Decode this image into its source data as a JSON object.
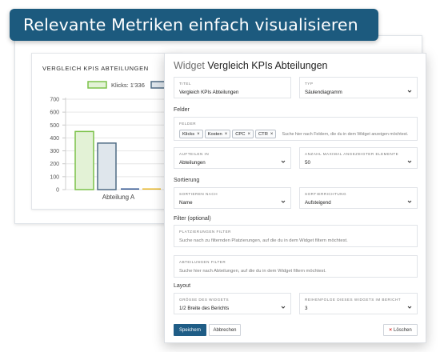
{
  "banner": {
    "text": "Relevante Metriken einfach visualisieren"
  },
  "chart_card": {
    "title": "VERGLEICH KPIS ABTEILUNGEN"
  },
  "chart_data": {
    "type": "bar",
    "legend_placement": "top",
    "categories": [
      "Abteilung A"
    ],
    "series": [
      {
        "name": "Klicks: 1'336",
        "values": [
          450
        ],
        "color": "#7cc24a",
        "fill": "#e3f2d6"
      },
      {
        "name": "",
        "values": [
          360
        ],
        "color": "#4f6b84",
        "fill": "#dfe6ec"
      },
      {
        "name": "",
        "values": [
          5
        ],
        "color": "#2a4f8c",
        "fill": "#2a4f8c"
      },
      {
        "name": "",
        "values": [
          5
        ],
        "color": "#e6b422",
        "fill": "#e6b422"
      }
    ],
    "yticks": [
      "700",
      "600",
      "500",
      "400",
      "300",
      "200",
      "100",
      "0"
    ],
    "ylim": [
      0,
      700
    ],
    "grid": true
  },
  "modal": {
    "title_prefix": "Widget",
    "title_main": "Vergleich KPIs Abteilungen",
    "titel": {
      "label": "TITEL",
      "value": "Vergleich KPIs Abteilungen"
    },
    "typ": {
      "label": "TYP",
      "value": "Säulendiagramm"
    },
    "section_felder": "Felder",
    "felder": {
      "label": "FELDER",
      "chips": [
        "Klicks",
        "Kosten",
        "CPC",
        "CTR"
      ],
      "remove_glyph": "×",
      "placeholder": "Suche hier nach Feldern, die du in dem Widget anzeigen möchtest."
    },
    "aufteilen": {
      "label": "AUFTEILEN IN",
      "value": "Abteilungen"
    },
    "anzahl": {
      "label": "ANZAHL MAXIMAL ANGEZEIGTER ELEMENTE",
      "value": "50"
    },
    "section_sortierung": "Sortierung",
    "sortieren": {
      "label": "SORTIEREN NACH",
      "value": "Name"
    },
    "richtung": {
      "label": "SORTIERRICHTUNG",
      "value": "Aufsteigend"
    },
    "section_filter": "Filter (optional)",
    "platz_filter": {
      "label": "PLATZIERUNGEN FILTER",
      "placeholder": "Suche nach zu filternden Platzierungen, auf die du in dem Widget filtern möchtest."
    },
    "abt_filter": {
      "label": "ABTEILUNGEN FILTER",
      "placeholder": "Suche hier nach Abteilungen, auf die du in dem Widget filtern möchtest."
    },
    "section_layout": "Layout",
    "groesse": {
      "label": "GRÖSSE DES WIDGETS",
      "value": "1/2 Breite des Berichts"
    },
    "reihenfolge": {
      "label": "REIHENFOLGE DIESES WIDGETS IM BERICHT",
      "value": "3"
    },
    "save_label": "Speichern",
    "cancel_label": "Abbrechen",
    "delete_glyph": "×",
    "delete_label": "Löschen"
  }
}
